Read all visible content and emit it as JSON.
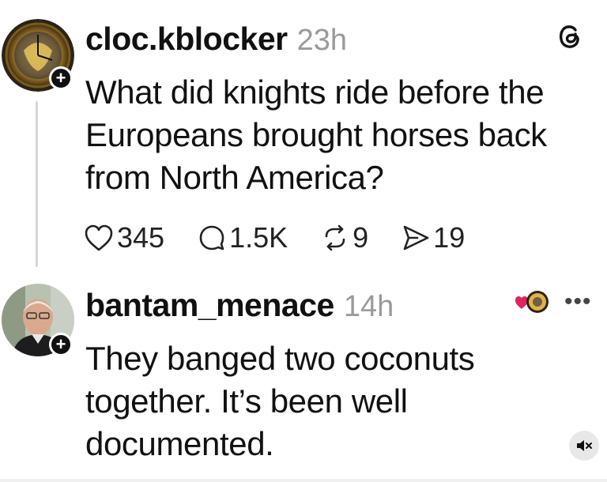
{
  "posts": [
    {
      "username": "cloc.kblocker",
      "time": "23h",
      "lines": [
        "What did knights ride before the",
        "Europeans brought horses back",
        "from North America?"
      ],
      "actions": {
        "likes": "345",
        "replies": "1.5K",
        "reposts": "9",
        "shares": "19"
      }
    },
    {
      "username": "bantam_menace",
      "time": "14h",
      "lines": [
        "They banged two coconuts",
        "together. It’s been well",
        "documented."
      ],
      "more": "•••"
    }
  ],
  "icons": {
    "threads": "threads-logo-icon",
    "follow": "plus-icon",
    "like": "heart-icon",
    "reply": "comment-icon",
    "repost": "repost-icon",
    "share": "share-icon",
    "reaction": "liked-by-author-icon",
    "mute": "speaker-mute-icon"
  },
  "colors": {
    "text": "#111111",
    "muted": "#9a9a9a",
    "heart": "#e0245e",
    "thread_line": "#d7d7d7"
  }
}
